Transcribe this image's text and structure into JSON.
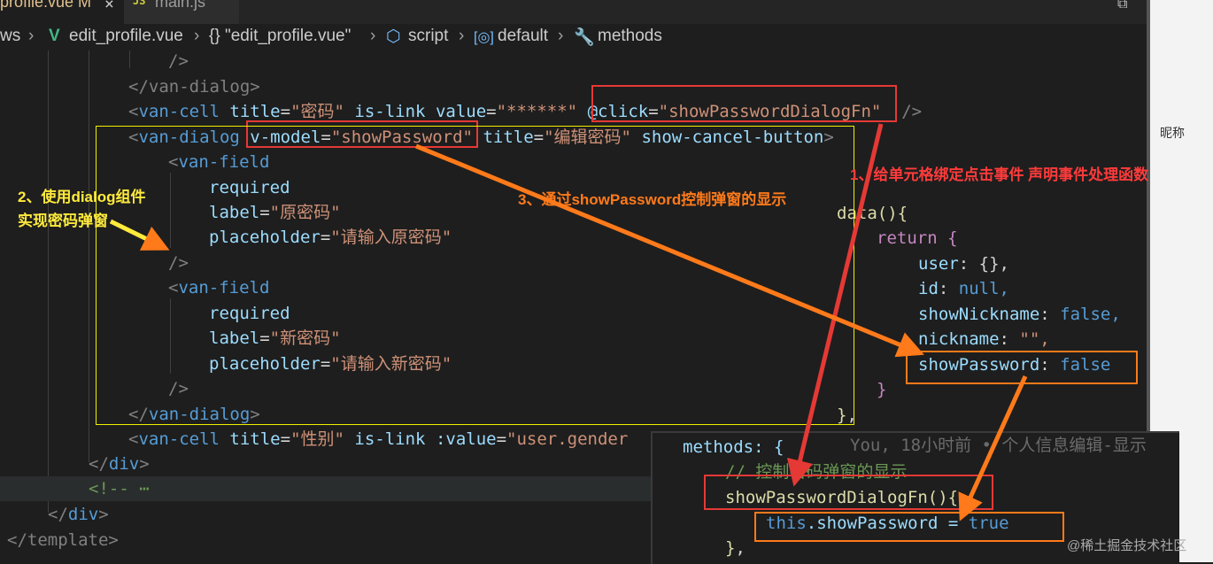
{
  "tabs": [
    {
      "label": "profile.vue M",
      "active": true
    },
    {
      "label": "main.js",
      "active": false
    }
  ],
  "breadcrumb": {
    "parts": [
      "ws",
      "edit_profile.vue",
      "{} \"edit_profile.vue\"",
      "script",
      "default",
      "methods"
    ]
  },
  "code": {
    "l1": "/>",
    "l2": "</van-dialog>",
    "l3_title": "\"密码\"",
    "l3_value": "\"******\"",
    "l3_click": "\"showPasswordDialogFn\"",
    "l4_vmodel": "\"showPassword\"",
    "l4_title": "\"编辑密码\"",
    "f1_label": "\"原密码\"",
    "f1_placeholder": "\"请输入原密码\"",
    "f2_label": "\"新密码\"",
    "f2_placeholder": "\"请输入新密码\"",
    "gender_title": "\"性别\"",
    "gender_value": "\"user.gender",
    "collapsed": "<!-- ⋯",
    "template_close": "</template>"
  },
  "data_panel": {
    "fn": "data(){",
    "ret": "return {",
    "user": "{},",
    "id": "null,",
    "nick": "false,",
    "nickname": "\"\",",
    "pw": "false"
  },
  "methods_panel": {
    "head": "methods: {",
    "comment": "// 控制密码弹窗的显示",
    "fn": "showPasswordDialogFn(){",
    "body_this": "this",
    "body_prop": ".showPassword = ",
    "body_val": "true",
    "blame": "You, 18小时前 • 个人信息编辑-显示"
  },
  "annotations": {
    "a1": "1、给单元格绑定点击事件 声明事件处理函数",
    "a2_line1": "2、使用dialog组件",
    "a2_line2": "实现密码弹窗",
    "a3": "3、通过showPassword控制弹窗的显示"
  },
  "side_panel": {
    "item": "昵称"
  },
  "watermark": "@稀土掘金技术社区",
  "colors": {
    "red": "#e53935",
    "orange": "#ff7a1a",
    "yellow": "#ffff00",
    "annotation_yellow": "#ffeb3b",
    "annotation_red": "#ff3b3b"
  }
}
